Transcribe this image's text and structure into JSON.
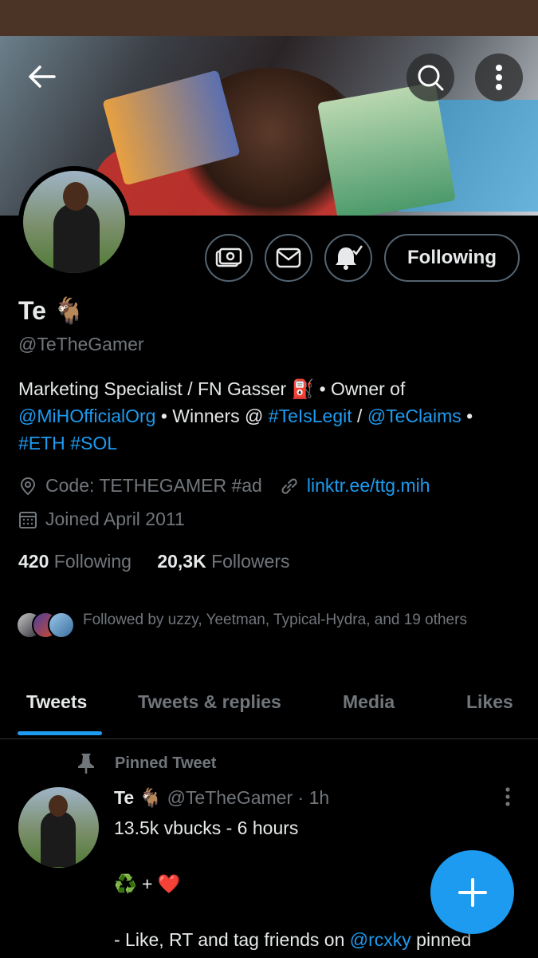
{
  "profile": {
    "name": "Te 🐐",
    "handle": "@TeTheGamer",
    "bio": {
      "line1_text": "Marketing Specialist / FN Gasser ⛽ • Owner of",
      "mention1": "@MiHOfficialOrg",
      "mid1": " • Winners @ ",
      "hashtag1": "#TeIsLegit",
      "sep": " / ",
      "mention2": "@TeClaims",
      "bullet": " •",
      "hashtag2": "#ETH",
      "hashtag3": "#SOL"
    },
    "location": "Code: TETHEGAMER #ad",
    "website": "linktr.ee/ttg.mih",
    "joined": "Joined April 2011",
    "following_count": "420",
    "following_label": "Following",
    "followers_count": "20,3K",
    "followers_label": "Followers",
    "followed_by": "Followed by uzzy, Yeetman, Typical-Hydra, and 19 others"
  },
  "actions": {
    "following_button": "Following",
    "icons": [
      "tip-icon",
      "message-icon",
      "notifications-icon"
    ]
  },
  "tabs": [
    "Tweets",
    "Tweets & replies",
    "Media",
    "Likes"
  ],
  "active_tab": "Tweets",
  "pinned_tweet": {
    "label": "Pinned Tweet",
    "author_name": "Te 🐐",
    "author_handle": "@TeTheGamer",
    "time": " · 1h",
    "line1": "13.5k vbucks - 6 hours",
    "line2": "♻️ + ❤️",
    "line3_text": "- Like, RT and tag friends on ",
    "line3_mention": "@rcxky",
    "line3_end": " pinned"
  },
  "colors": {
    "accent": "#1d9bf0",
    "muted_text": "#71767b",
    "background": "#000000",
    "status_bar": "#4b3425"
  }
}
